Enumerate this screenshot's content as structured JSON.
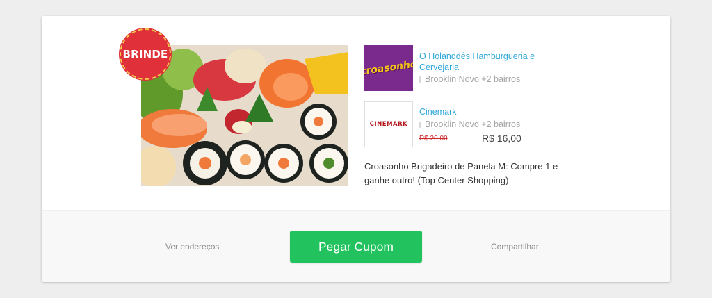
{
  "badge": {
    "label": "BRINDE"
  },
  "deal_image": {
    "alt": "sushi-platter"
  },
  "merchants": [
    {
      "logo_text": "croasonho",
      "name": "O Holanddês Hamburgueria e Cervejaria",
      "location": "Brooklin Novo +2 bairros"
    },
    {
      "logo_text": "CINEMARK",
      "name": "Cinemark",
      "location": "Brooklin Novo +2 bairros"
    }
  ],
  "price": {
    "old": "R$ 20,00",
    "new": "R$ 16,00"
  },
  "deal": {
    "title": "Croasonho Brigadeiro de Panela M: Compre 1 e ganhe outro! (Top Center Shopping)"
  },
  "actions": {
    "addresses_label": "Ver endereços",
    "coupon_label": "Pegar Cupom",
    "share_label": "Compartilhar"
  },
  "colors": {
    "badge": "#e0303a",
    "link": "#2fa8d9",
    "button": "#22c35e",
    "old_price": "#cc2b2b"
  }
}
